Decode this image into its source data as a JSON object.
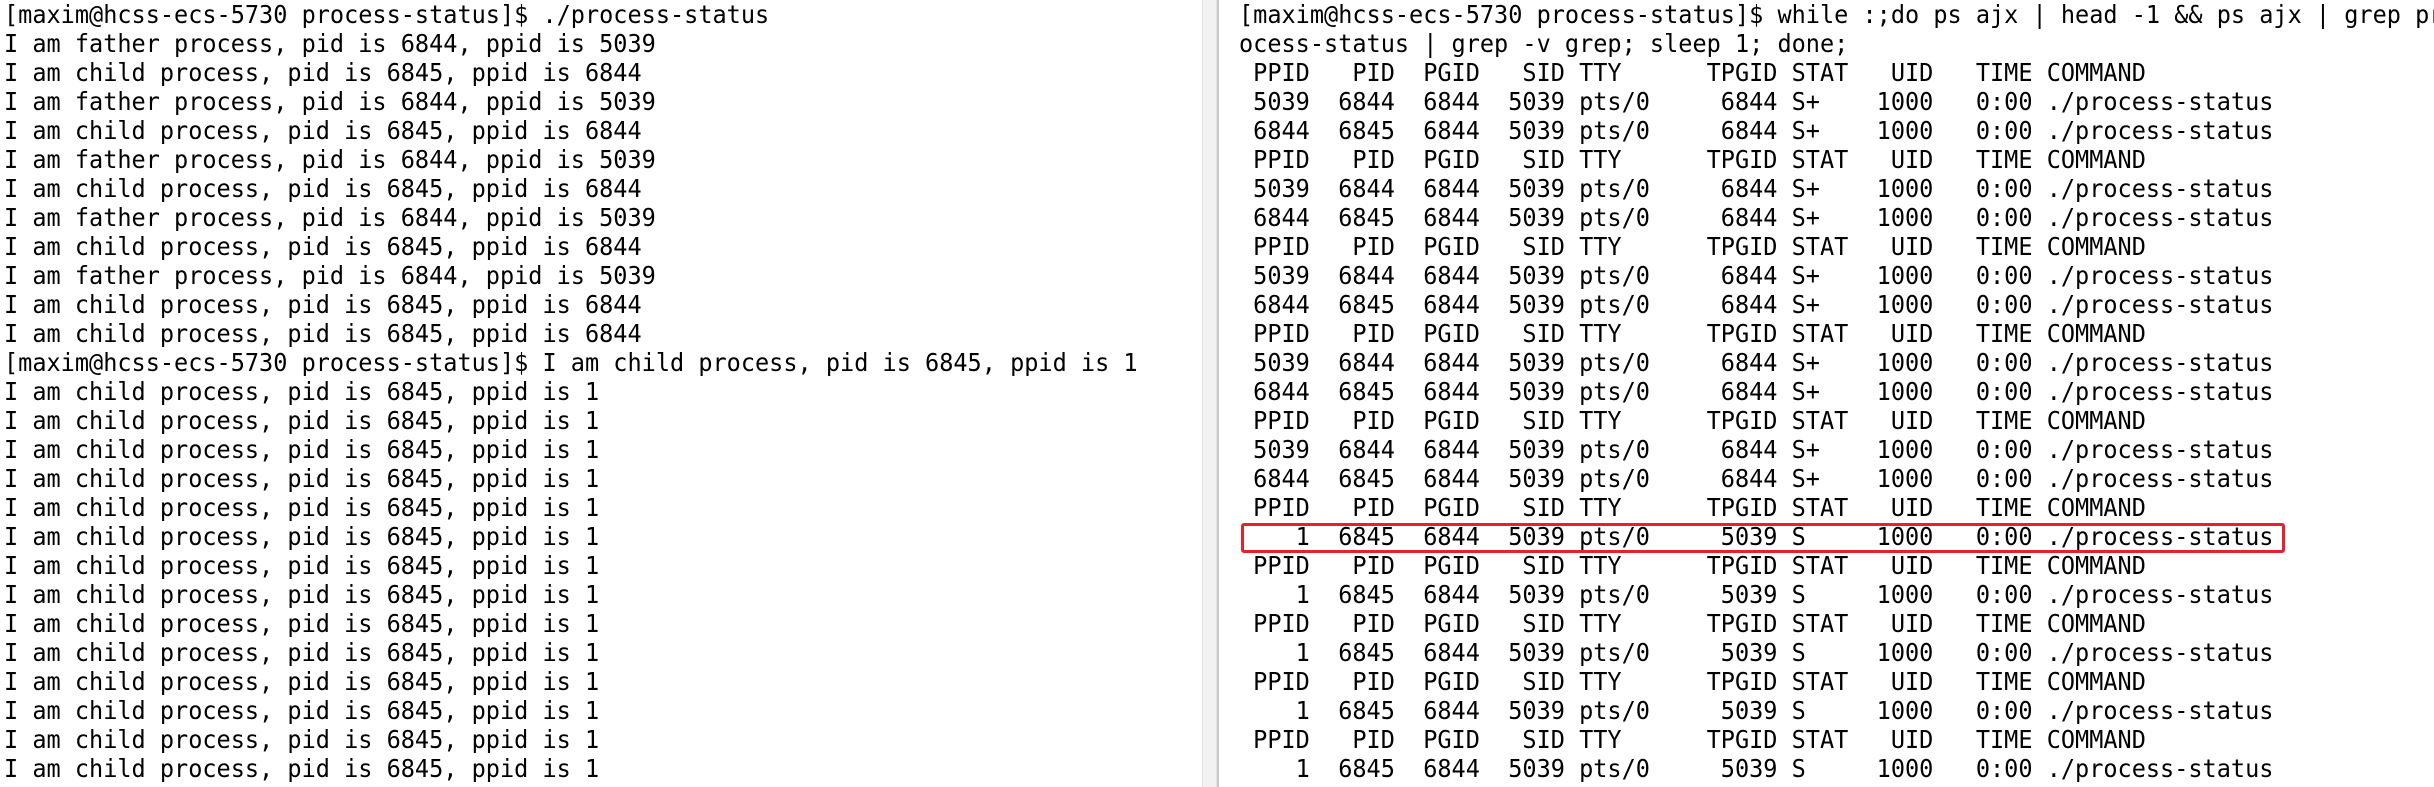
{
  "left_terminal": {
    "lines": [
      "[maxim@hcss-ecs-5730 process-status]$ ./process-status",
      "I am father process, pid is 6844, ppid is 5039",
      "I am child process, pid is 6845, ppid is 6844",
      "I am father process, pid is 6844, ppid is 5039",
      "I am child process, pid is 6845, ppid is 6844",
      "I am father process, pid is 6844, ppid is 5039",
      "I am child process, pid is 6845, ppid is 6844",
      "I am father process, pid is 6844, ppid is 5039",
      "I am child process, pid is 6845, ppid is 6844",
      "I am father process, pid is 6844, ppid is 5039",
      "I am child process, pid is 6845, ppid is 6844",
      "I am child process, pid is 6845, ppid is 6844",
      "[maxim@hcss-ecs-5730 process-status]$ I am child process, pid is 6845, ppid is 1",
      "I am child process, pid is 6845, ppid is 1",
      "I am child process, pid is 6845, ppid is 1",
      "I am child process, pid is 6845, ppid is 1",
      "I am child process, pid is 6845, ppid is 1",
      "I am child process, pid is 6845, ppid is 1",
      "I am child process, pid is 6845, ppid is 1",
      "I am child process, pid is 6845, ppid is 1",
      "I am child process, pid is 6845, ppid is 1",
      "I am child process, pid is 6845, ppid is 1",
      "I am child process, pid is 6845, ppid is 1",
      "I am child process, pid is 6845, ppid is 1",
      "I am child process, pid is 6845, ppid is 1",
      "I am child process, pid is 6845, ppid is 1",
      "I am child process, pid is 6845, ppid is 1"
    ]
  },
  "right_terminal": {
    "lines": [
      "[maxim@hcss-ecs-5730 process-status]$ while :;do ps ajx | head -1 && ps ajx | grep pr",
      "ocess-status | grep -v grep; sleep 1; done;",
      " PPID   PID  PGID   SID TTY      TPGID STAT   UID   TIME COMMAND",
      " 5039  6844  6844  5039 pts/0     6844 S+    1000   0:00 ./process-status",
      " 6844  6845  6844  5039 pts/0     6844 S+    1000   0:00 ./process-status",
      " PPID   PID  PGID   SID TTY      TPGID STAT   UID   TIME COMMAND",
      " 5039  6844  6844  5039 pts/0     6844 S+    1000   0:00 ./process-status",
      " 6844  6845  6844  5039 pts/0     6844 S+    1000   0:00 ./process-status",
      " PPID   PID  PGID   SID TTY      TPGID STAT   UID   TIME COMMAND",
      " 5039  6844  6844  5039 pts/0     6844 S+    1000   0:00 ./process-status",
      " 6844  6845  6844  5039 pts/0     6844 S+    1000   0:00 ./process-status",
      " PPID   PID  PGID   SID TTY      TPGID STAT   UID   TIME COMMAND",
      " 5039  6844  6844  5039 pts/0     6844 S+    1000   0:00 ./process-status",
      " 6844  6845  6844  5039 pts/0     6844 S+    1000   0:00 ./process-status",
      " PPID   PID  PGID   SID TTY      TPGID STAT   UID   TIME COMMAND",
      " 5039  6844  6844  5039 pts/0     6844 S+    1000   0:00 ./process-status",
      " 6844  6845  6844  5039 pts/0     6844 S+    1000   0:00 ./process-status",
      " PPID   PID  PGID   SID TTY      TPGID STAT   UID   TIME COMMAND",
      "    1  6845  6844  5039 pts/0     5039 S     1000   0:00 ./process-status",
      " PPID   PID  PGID   SID TTY      TPGID STAT   UID   TIME COMMAND",
      "    1  6845  6844  5039 pts/0     5039 S     1000   0:00 ./process-status",
      " PPID   PID  PGID   SID TTY      TPGID STAT   UID   TIME COMMAND",
      "    1  6845  6844  5039 pts/0     5039 S     1000   0:00 ./process-status",
      " PPID   PID  PGID   SID TTY      TPGID STAT   UID   TIME COMMAND",
      "    1  6845  6844  5039 pts/0     5039 S     1000   0:00 ./process-status",
      " PPID   PID  PGID   SID TTY      TPGID STAT   UID   TIME COMMAND",
      "    1  6845  6844  5039 pts/0     5039 S     1000   0:00 ./process-status"
    ],
    "highlighted_line_index": 18,
    "highlight_color": "#e8202a"
  },
  "colors": {
    "background": "#ffffff",
    "text": "#000000",
    "divider": "#c8c8c8"
  }
}
